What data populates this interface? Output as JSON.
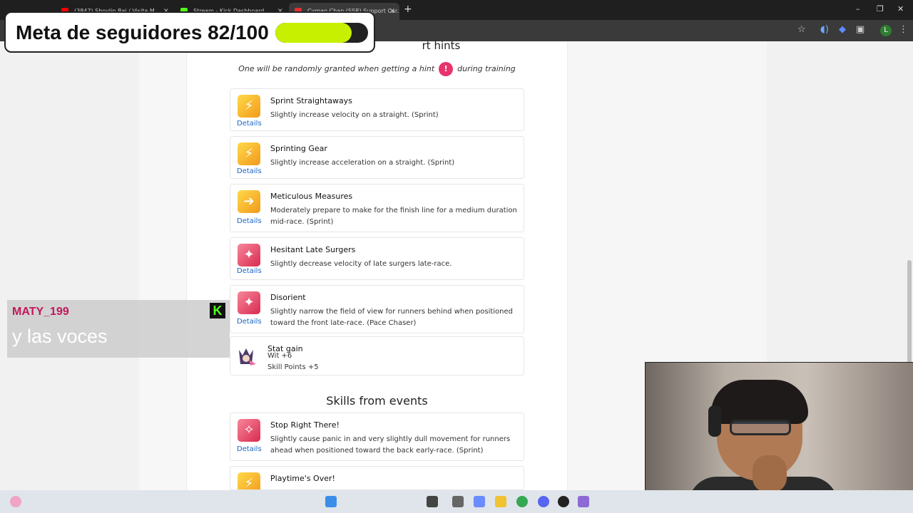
{
  "browser": {
    "tabs": [
      {
        "label": "(3847) Shovlin Bai / Visita M...",
        "color": "#ff0000"
      },
      {
        "label": "Stream - Kick Dashboard",
        "color": "#53fc18"
      },
      {
        "label": "Cyman Chan (SSR) Support Car...",
        "color": "#e03131"
      }
    ],
    "new_tab_label": "+",
    "profile_initial": "L"
  },
  "page": {
    "support_hints_heading": "rt hints",
    "hint_note_before": "One will be randomly granted when getting a hint",
    "hint_badge": "!",
    "hint_note_after": "during training",
    "details_label": "Details",
    "support_hints": [
      {
        "name": "Sprint Straightaways",
        "desc": "Slightly increase velocity on a straight. (Sprint)",
        "icon": "sprint-icon",
        "tone": "gold"
      },
      {
        "name": "Sprinting Gear",
        "desc": "Slightly increase acceleration on a straight. (Sprint)",
        "icon": "sprint-icon",
        "tone": "gold"
      },
      {
        "name": "Meticulous Measures",
        "desc": "Moderately prepare to make for the finish line for a medium duration mid-race. (Sprint)",
        "icon": "arrow-icon",
        "tone": "gold"
      },
      {
        "name": "Hesitant Late Surgers",
        "desc": "Slightly decrease velocity of late surgers late-race.",
        "icon": "debuff-icon",
        "tone": "red"
      },
      {
        "name": "Disorient",
        "desc": "Slightly narrow the field of view for runners behind when positioned toward the front late-race. (Pace Chaser)",
        "icon": "debuff-icon",
        "tone": "red"
      }
    ],
    "stat_gain": {
      "title": "Stat gain",
      "lines": [
        "Wit +6",
        "Skill Points +5"
      ]
    },
    "events_heading": "Skills from events",
    "event_skills": [
      {
        "name": "Stop Right There!",
        "desc": "Slightly cause panic in and very slightly dull movement for runners ahead when positioned toward the back early-race. (Sprint)",
        "icon": "sparkle-icon",
        "tone": "red"
      },
      {
        "name": "Playtime's Over!",
        "desc": "",
        "icon": "sprint-icon",
        "tone": "gold"
      }
    ]
  },
  "overlay": {
    "goal_text": "Meta de seguidores 82/100",
    "goal_progress": 0.82,
    "chat_user": "MATY_199",
    "chat_message": "y las voces",
    "kick_letter": "K"
  },
  "colors": {
    "hint_badge": "#e8336d",
    "goal_fill": "#c7f000",
    "chat_user": "#c2185b",
    "link": "#1a63c7"
  }
}
